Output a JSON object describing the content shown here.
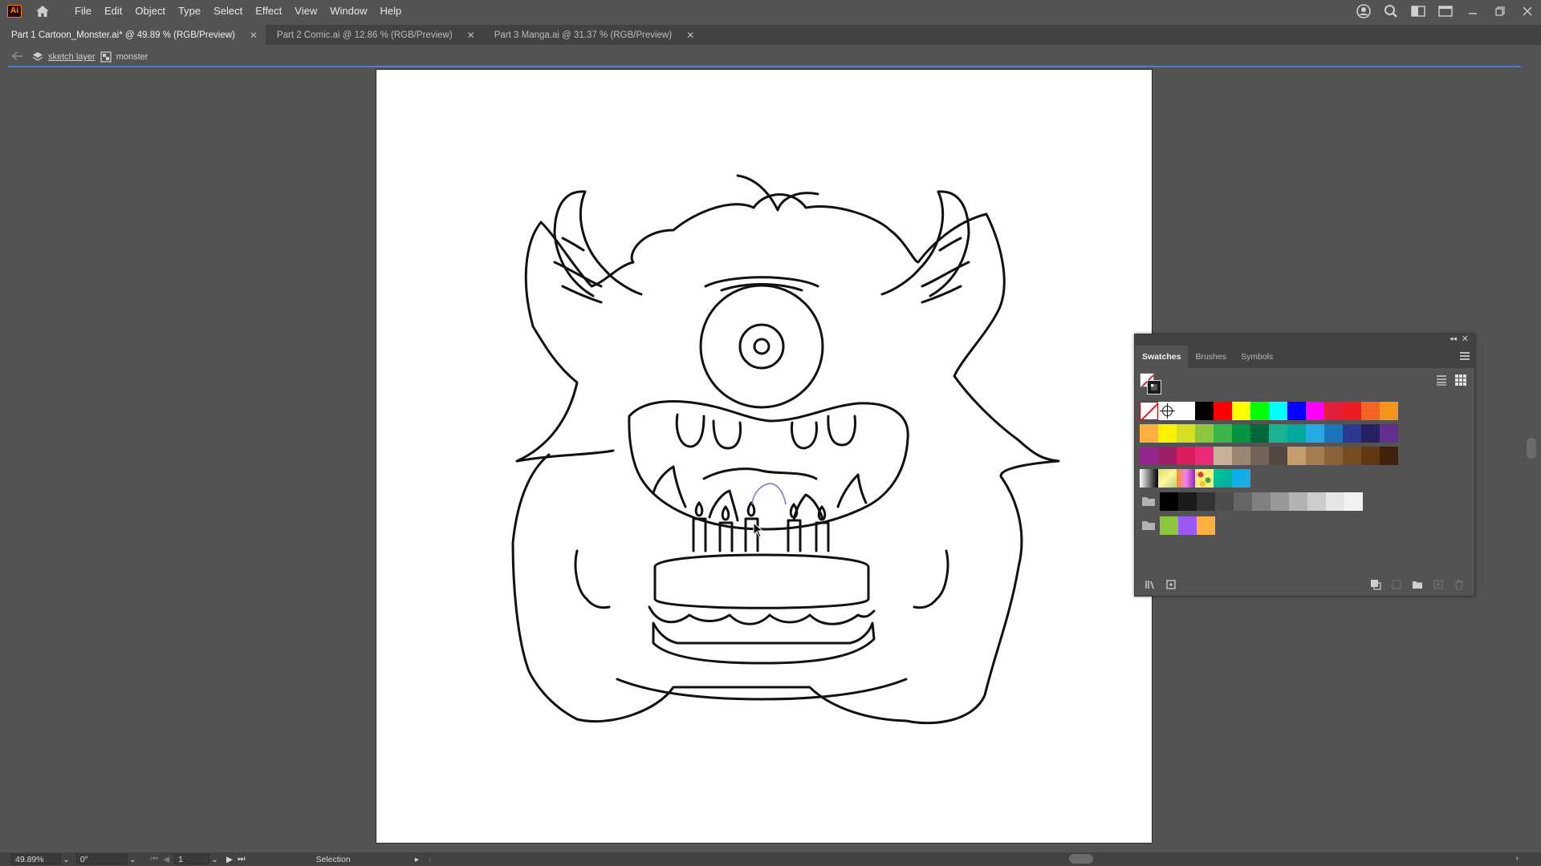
{
  "app": {
    "logo_text": "Ai"
  },
  "menu": [
    "File",
    "Edit",
    "Object",
    "Type",
    "Select",
    "Effect",
    "View",
    "Window",
    "Help"
  ],
  "tabs": [
    {
      "label": "Part 1 Cartoon_Monster.ai* @ 49.89 % (RGB/Preview)",
      "active": true
    },
    {
      "label": "Part 2 Comic.ai @ 12.86 % (RGB/Preview)",
      "active": false
    },
    {
      "label": "Part 3 Manga.ai @ 31.37 % (RGB/Preview)",
      "active": false
    }
  ],
  "breadcrumb": {
    "layer": "sketch layer",
    "group": "monster"
  },
  "swatches_panel": {
    "tabs": [
      "Swatches",
      "Brushes",
      "Symbols"
    ],
    "row1": [
      "#ffffff",
      "#000000",
      "#ff0000",
      "#ffff00",
      "#00ff00",
      "#00ffff",
      "#0000ff",
      "#ff00ff",
      "#e0203a",
      "#ed1c24",
      "#f26522",
      "#f7941d"
    ],
    "row2": [
      "#fbb040",
      "#fff200",
      "#d7df23",
      "#8dc63f",
      "#39b54a",
      "#009444",
      "#006838",
      "#1bb38f",
      "#00a99d",
      "#27aae1",
      "#1c75bc",
      "#2b3990",
      "#262262",
      "#662d91"
    ],
    "row3": [
      "#92278f",
      "#9e1f63",
      "#da1c5c",
      "#ee2a7b",
      "#c7b299",
      "#998675",
      "#736357",
      "#534741",
      "#c69c6d",
      "#a67c52",
      "#8c6239",
      "#754c24",
      "#603813",
      "#42210b"
    ],
    "row4_gradients": [
      "linear-gradient(90deg,#ffffff,#000000)",
      "linear-gradient(135deg,#d4e157,#fff59d,#aed581)",
      "linear-gradient(90deg,#f7941d,#ee82ee,#9c27b0)",
      "pattern",
      "linear-gradient(135deg,#00c897,#00a99d)",
      "linear-gradient(135deg,#00aeef,#27aae1)"
    ],
    "grays": [
      "#000000",
      "#1a1a1a",
      "#333333",
      "#4d4d4d",
      "#666666",
      "#808080",
      "#999999",
      "#b3b3b3",
      "#cccccc",
      "#e6e6e6",
      "#f2f2f2"
    ],
    "bright": [
      "#8cc63f",
      "#9b59f6",
      "#fbb040"
    ]
  },
  "status": {
    "zoom": "49.89%",
    "rotation": "0°",
    "artboard": "1",
    "tool": "Selection"
  }
}
